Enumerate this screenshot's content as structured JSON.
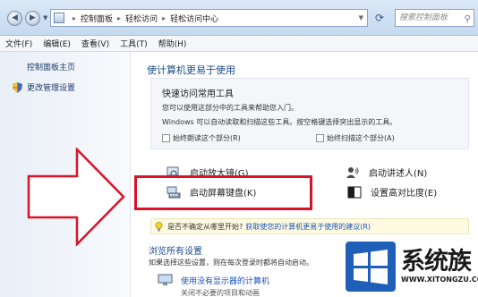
{
  "address_bar": {
    "breadcrumbs": [
      "控制面板",
      "轻松访问",
      "轻松访问中心"
    ],
    "search_placeholder": "搜索控制面板"
  },
  "menu": [
    "文件(F)",
    "编辑(E)",
    "查看(V)",
    "工具(T)",
    "帮助(H)"
  ],
  "left_pane": {
    "home": "控制面板主页",
    "admin": "更改管理设置"
  },
  "main": {
    "title": "使计算机更易于使用",
    "quick_access": {
      "title": "快速访问常用工具",
      "line1": "您可以使用这部分中的工具来帮助您入门。",
      "line2": "Windows 可以自动读取和扫描这些工具。按空格键选择突出显示的工具。",
      "check1": "始终朗读这个部分(R)",
      "check2": "始终扫描这个部分(A)"
    },
    "tools": {
      "magnifier": "启动放大镜(G)",
      "narrator": "启动讲述人(N)",
      "keyboard": "启动屏幕键盘(K)",
      "contrast": "设置高对比度(E)"
    },
    "info": {
      "question": "是否不确定从哪里开始?",
      "link": "获取使您的计算机更易于使用的建议(R)"
    },
    "browse": {
      "title": "浏览所有设置",
      "subtitle": "如果选择这些设置，则在每次登录时都将自动启动。",
      "item1": "使用没有显示器的计算机",
      "item2": "关闭不必要的项目和动画"
    }
  },
  "watermark": {
    "brand": "系统族",
    "url": "WWW.XITONGZU.COM"
  },
  "colors": {
    "highlight_border": "#d8142a",
    "link": "#1a52b3",
    "heading": "#1b4c8c"
  }
}
